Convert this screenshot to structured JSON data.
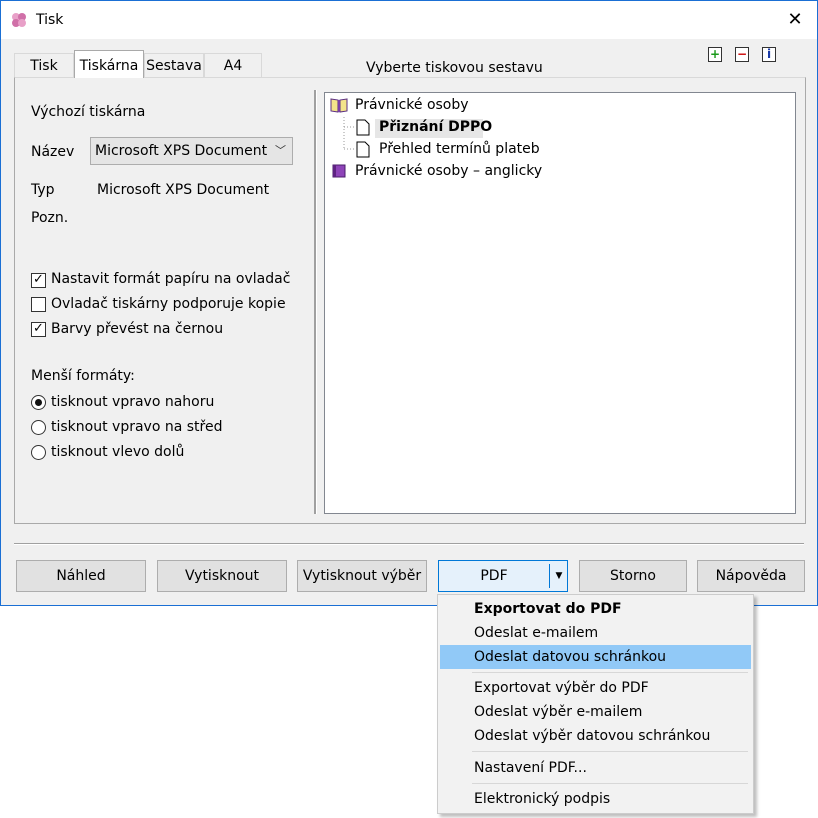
{
  "window": {
    "title": "Tisk"
  },
  "tabs": [
    {
      "label": "Tisk",
      "active": false
    },
    {
      "label": "Tiskárna",
      "active": true
    },
    {
      "label": "Sestava",
      "active": false
    },
    {
      "label": "A4",
      "active": false
    }
  ],
  "printer": {
    "heading": "Výchozí tiskárna",
    "name_label": "Název",
    "name_value": "Microsoft XPS Document Writer",
    "type_label": "Typ",
    "type_value": "Microsoft XPS Document",
    "note_label": "Pozn."
  },
  "options": [
    {
      "label": "Nastavit formát papíru na ovladač",
      "checked": true
    },
    {
      "label": "Ovladač tiskárny podporuje kopie",
      "checked": false
    },
    {
      "label": "Barvy převést na černou",
      "checked": true
    }
  ],
  "small_formats": {
    "heading": "Menší formáty:",
    "items": [
      {
        "label": "tisknout vpravo nahoru",
        "selected": true
      },
      {
        "label": "tisknout vpravo na střed",
        "selected": false
      },
      {
        "label": "tisknout vlevo dolů",
        "selected": false
      }
    ]
  },
  "report_tree": {
    "heading": "Vyberte tiskovou sestavu",
    "nodes": [
      {
        "label": "Právnické osoby",
        "icon": "book-open-icon"
      },
      {
        "label": "Přiznání DPPO",
        "icon": "page-icon",
        "selected": true
      },
      {
        "label": "Přehled termínů plateb",
        "icon": "page-icon"
      },
      {
        "label": "Právnické osoby – anglicky",
        "icon": "book-closed-icon"
      }
    ]
  },
  "tools": {
    "add": "+",
    "remove": "−",
    "info": "i"
  },
  "buttons": {
    "preview": "Náhled",
    "print": "Vytisknout",
    "print_selection": "Vytisknout výběr",
    "pdf": "PDF",
    "cancel": "Storno",
    "help": "Nápověda"
  },
  "pdf_menu": [
    {
      "label": "Exportovat do PDF",
      "bold": true
    },
    {
      "label": "Odeslat e-mailem"
    },
    {
      "label": "Odeslat datovou schránkou",
      "highlighted": true
    },
    {
      "label": "Exportovat výběr do PDF"
    },
    {
      "label": "Odeslat výběr e-mailem"
    },
    {
      "label": "Odeslat výběr datovou schránkou"
    },
    {
      "label": "Nastavení PDF..."
    },
    {
      "label": "Elektronický podpis"
    }
  ],
  "colors": {
    "accent": "#0078d7",
    "highlight": "#91c9f7",
    "window_border": "#1a6fd4"
  }
}
